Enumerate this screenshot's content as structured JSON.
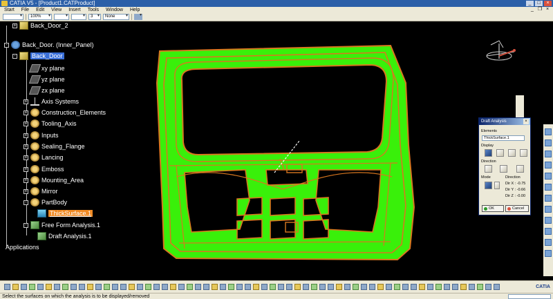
{
  "window": {
    "title": "CATIA V5 - [Product1.CATProduct]"
  },
  "menu": [
    "Start",
    "File",
    "Edit",
    "View",
    "Insert",
    "Tools",
    "Window",
    "Help"
  ],
  "toolbar": {
    "zoom": "100%",
    "line_weight": "3",
    "layer": "None"
  },
  "tree": {
    "nodes": [
      {
        "label": "Back_Door_2",
        "icon": "part-icon"
      },
      {
        "label": "Back_Door. (Inner_Panel)",
        "icon": "product-icon"
      },
      {
        "label": "Back_Door",
        "icon": "part-icon",
        "selected": true
      },
      {
        "label": "xy plane",
        "icon": "plane-icon"
      },
      {
        "label": "yz plane",
        "icon": "plane-icon"
      },
      {
        "label": "zx plane",
        "icon": "plane-icon"
      },
      {
        "label": "Axis Systems",
        "icon": "axis-icon"
      },
      {
        "label": "Construction_Elements",
        "icon": "geometrical-set-icon"
      },
      {
        "label": "Tooling_Axis",
        "icon": "geometrical-set-icon"
      },
      {
        "label": "Inputs",
        "icon": "geometrical-set-icon"
      },
      {
        "label": "Sealing_Flange",
        "icon": "geometrical-set-icon"
      },
      {
        "label": "Lancing",
        "icon": "geometrical-set-icon"
      },
      {
        "label": "Emboss",
        "icon": "geometrical-set-icon"
      },
      {
        "label": "Mounting_Area",
        "icon": "geometrical-set-icon"
      },
      {
        "label": "Mirror",
        "icon": "geometrical-set-icon"
      },
      {
        "label": "PartBody",
        "icon": "body-icon"
      },
      {
        "label": "ThickSurface.1",
        "icon": "surface-icon",
        "highlighted": true
      },
      {
        "label": "Free Form Analysis.1",
        "icon": "analysis-icon"
      },
      {
        "label": "Draft Analysis.1",
        "icon": "analysis-icon"
      },
      {
        "label": "Applications",
        "icon": "none"
      }
    ]
  },
  "dialog": {
    "title": "Draft Analysis",
    "elements_label": "Elements",
    "elements_value": "ThickSurface.1",
    "display_label": "Display",
    "direction_label": "Direction",
    "mode_label": "Mode",
    "direction_group": "Direction",
    "dir_x": "Dir X : -0.75",
    "dir_y": "Dir Y : -0.66",
    "dir_z": "Dir Z : -0.00",
    "ok": "OK",
    "cancel": "Cancel"
  },
  "colors": {
    "surface": "#39f00a",
    "flange": "#d9771f",
    "background": "#000000",
    "selection": "#3a6fd8",
    "highlight": "#f08a24"
  },
  "status": {
    "message": "Select the surfaces on which the analysis is to be displayed/removed"
  },
  "logo": "CATIA"
}
